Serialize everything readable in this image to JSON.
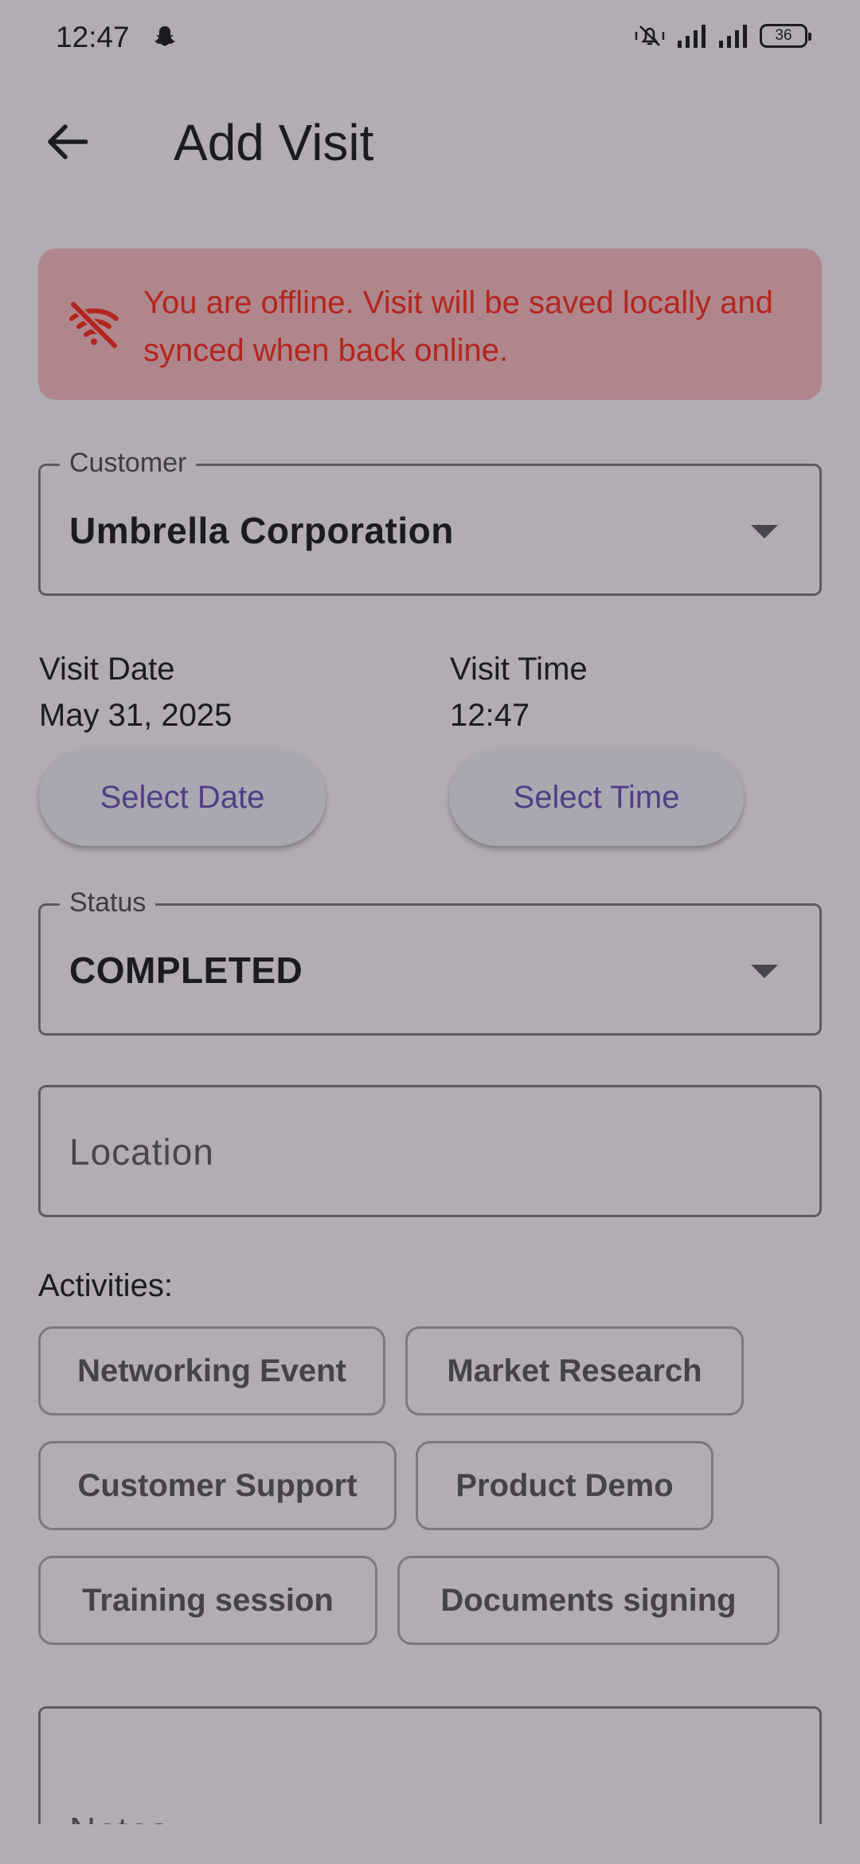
{
  "status_bar": {
    "time": "12:47",
    "battery": "36",
    "icons": [
      "snapchat-icon",
      "mute-icon",
      "signal-icon",
      "signal-icon",
      "battery-icon"
    ]
  },
  "app_bar": {
    "title": "Add Visit",
    "back_icon": "arrow-left-icon"
  },
  "offline_banner": {
    "icon": "wifi-off-icon",
    "message": "You are offline. Visit will be saved locally and synced when back online.",
    "text_color": "#b3261e",
    "background": "#b0868d"
  },
  "customer": {
    "label": "Customer",
    "value": "Umbrella Corporation"
  },
  "visit_date": {
    "label": "Visit Date",
    "value": "May 31, 2025",
    "button": "Select Date"
  },
  "visit_time": {
    "label": "Visit Time",
    "value": "12:47",
    "button": "Select Time"
  },
  "status": {
    "label": "Status",
    "value": "COMPLETED"
  },
  "location": {
    "placeholder": "Location"
  },
  "activities": {
    "label": "Activities:",
    "chips": [
      "Networking Event",
      "Market Research",
      "Customer Support",
      "Product Demo",
      "Training session",
      "Documents signing"
    ]
  },
  "notes": {
    "placeholder": "Notes"
  },
  "colors": {
    "background": "#b1adb3",
    "accent_text": "#4e3f86"
  }
}
